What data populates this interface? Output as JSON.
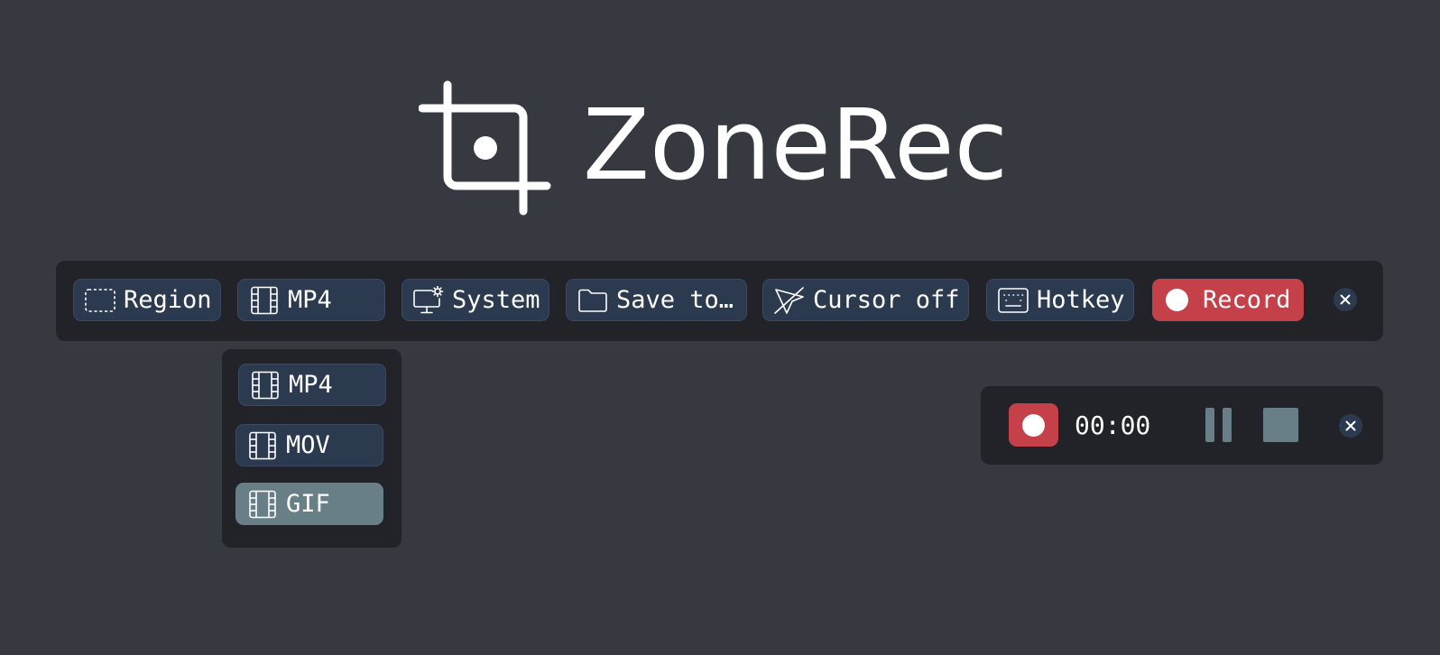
{
  "app": {
    "title": "ZoneRec",
    "logo_icon": "crop-icon"
  },
  "toolbar": {
    "region_label": "Region",
    "format_label": "MP4",
    "audio_label": "System",
    "save_label": "Save to…",
    "cursor_label": "Cursor off",
    "hotkey_label": "Hotkey",
    "record_label": "Record",
    "icons": {
      "region": "dashed-rectangle-icon",
      "format": "film-icon",
      "audio": "monitor-gear-icon",
      "save": "folder-icon",
      "cursor": "cursor-off-icon",
      "hotkey": "keyboard-icon",
      "record": "record-dot-icon",
      "close": "close-icon"
    }
  },
  "format_menu": {
    "options": [
      {
        "label": "MP4",
        "icon": "film-icon"
      },
      {
        "label": "MOV",
        "icon": "film-icon"
      },
      {
        "label": "GIF",
        "icon": "film-icon",
        "selected": true
      }
    ]
  },
  "recorder": {
    "time": "00:00",
    "icons": {
      "record": "record-icon",
      "pause": "pause-icon",
      "stop": "stop-icon",
      "close": "close-icon"
    }
  },
  "colors": {
    "background": "#36393f",
    "panel": "#212329",
    "button": "#2c3a50",
    "record_accent": "#c5414a",
    "selected": "#687f88",
    "text": "#ffffff"
  }
}
